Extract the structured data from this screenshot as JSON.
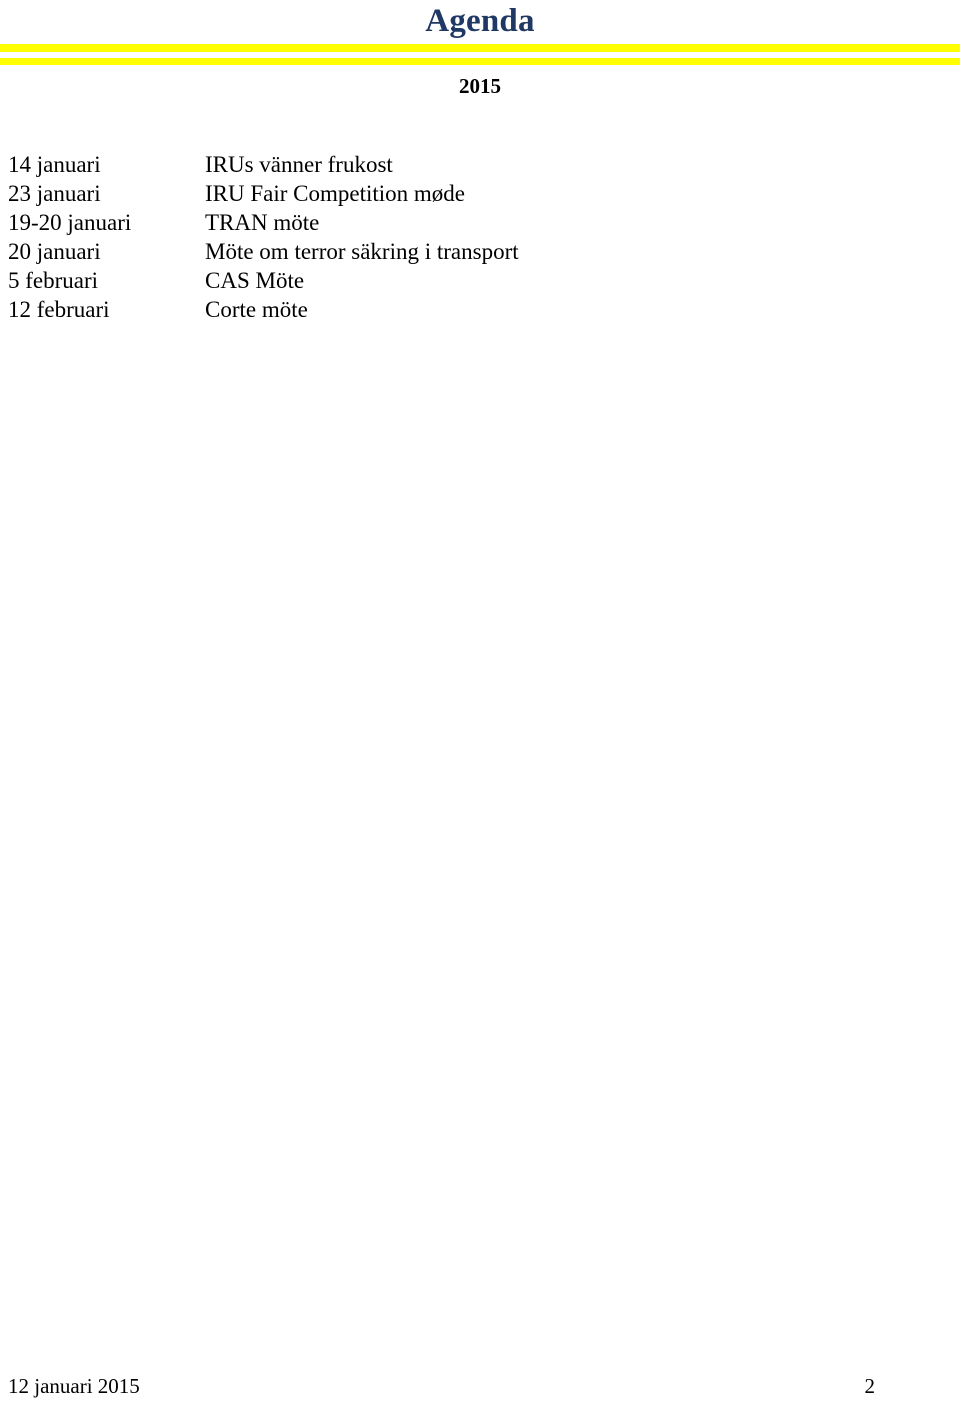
{
  "header": {
    "title": "Agenda",
    "title_color": "#1F3864",
    "rule_color": "#FFFF00",
    "year": "2015"
  },
  "agenda": {
    "rows": [
      {
        "date": "14 januari",
        "description": "IRUs vänner frukost"
      },
      {
        "date": "23 januari",
        "description": "IRU Fair Competition møde"
      },
      {
        "date": "19-20 januari",
        "description": "TRAN möte"
      },
      {
        "date": "20 januari",
        "description": "Möte om terror säkring i transport"
      },
      {
        "date": "5 februari",
        "description": "CAS Möte"
      },
      {
        "date": "12 februari",
        "description": "Corte möte"
      }
    ]
  },
  "footer": {
    "date": "12 januari 2015",
    "page_number": "2"
  }
}
